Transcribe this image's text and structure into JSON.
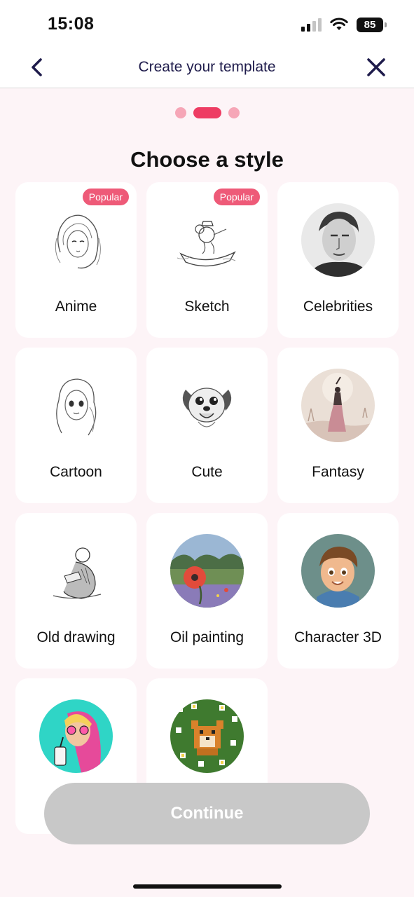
{
  "status_bar": {
    "time": "15:08",
    "battery": "85"
  },
  "nav": {
    "title": "Create your template"
  },
  "heading": "Choose a style",
  "styles": [
    {
      "label": "Anime",
      "badge": "Popular",
      "icon": "anime-girl-sketch"
    },
    {
      "label": "Sketch",
      "badge": "Popular",
      "icon": "mouse-boat-sketch"
    },
    {
      "label": "Celebrities",
      "badge": "",
      "icon": "celebrity-portrait"
    },
    {
      "label": "Cartoon",
      "badge": "",
      "icon": "cartoon-girl-sketch"
    },
    {
      "label": "Cute",
      "badge": "",
      "icon": "cute-dog-sketch"
    },
    {
      "label": "Fantasy",
      "badge": "",
      "icon": "fantasy-woman"
    },
    {
      "label": "Old drawing",
      "badge": "",
      "icon": "old-man-engraving"
    },
    {
      "label": "Oil painting",
      "badge": "",
      "icon": "poppy-oil-painting"
    },
    {
      "label": "Character 3D",
      "badge": "",
      "icon": "3d-boy"
    },
    {
      "label": "",
      "badge": "",
      "icon": "pop-art-woman"
    },
    {
      "label": "",
      "badge": "",
      "icon": "pixel-dog-flowers"
    }
  ],
  "continue_label": "Continue",
  "colors": {
    "accent": "#ee3c63",
    "badge": "#ee5a78",
    "dot_inactive": "#f6a6b7",
    "button_disabled": "#c8c8c8",
    "nav_icon": "#1e1b4b"
  }
}
